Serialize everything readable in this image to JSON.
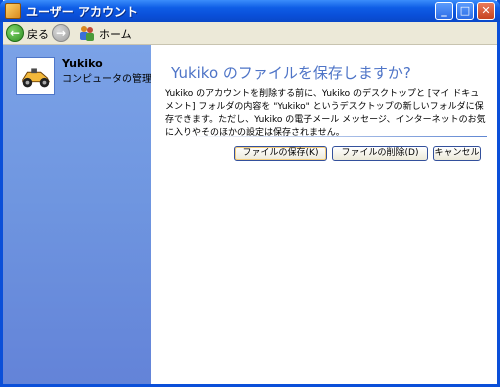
{
  "window": {
    "title": "ユーザー アカウント"
  },
  "toolbar": {
    "back_label": "戻る",
    "home_label": "ホーム"
  },
  "sidebar": {
    "user_name": "Yukiko",
    "user_role": "コンピュータの管理者"
  },
  "main": {
    "heading": "Yukiko のファイルを保存しますか?",
    "description": "Yukiko のアカウントを削除する前に、Yukiko のデスクトップと [マイ ドキュメント] フォルダの内容を \"Yukiko\" というデスクトップの新しいフォルダに保存できます。ただし、Yukiko の電子メール メッセージ、インターネットのお気に入りやそのほかの設定は保存されません。",
    "buttons": {
      "save": "ファイルの保存(K)",
      "delete": "ファイルの削除(D)",
      "cancel": "キャンセル"
    }
  },
  "colors": {
    "titlebar": "#0a4fd9",
    "sidebar": "#7ba2e7",
    "heading": "#4e74c7",
    "toolbar": "#ece9d8"
  },
  "icons": {
    "title": "user-accounts-icon",
    "back": "back-arrow-icon",
    "forward": "forward-arrow-icon",
    "home": "home-icon",
    "avatar": "race-car-icon"
  }
}
